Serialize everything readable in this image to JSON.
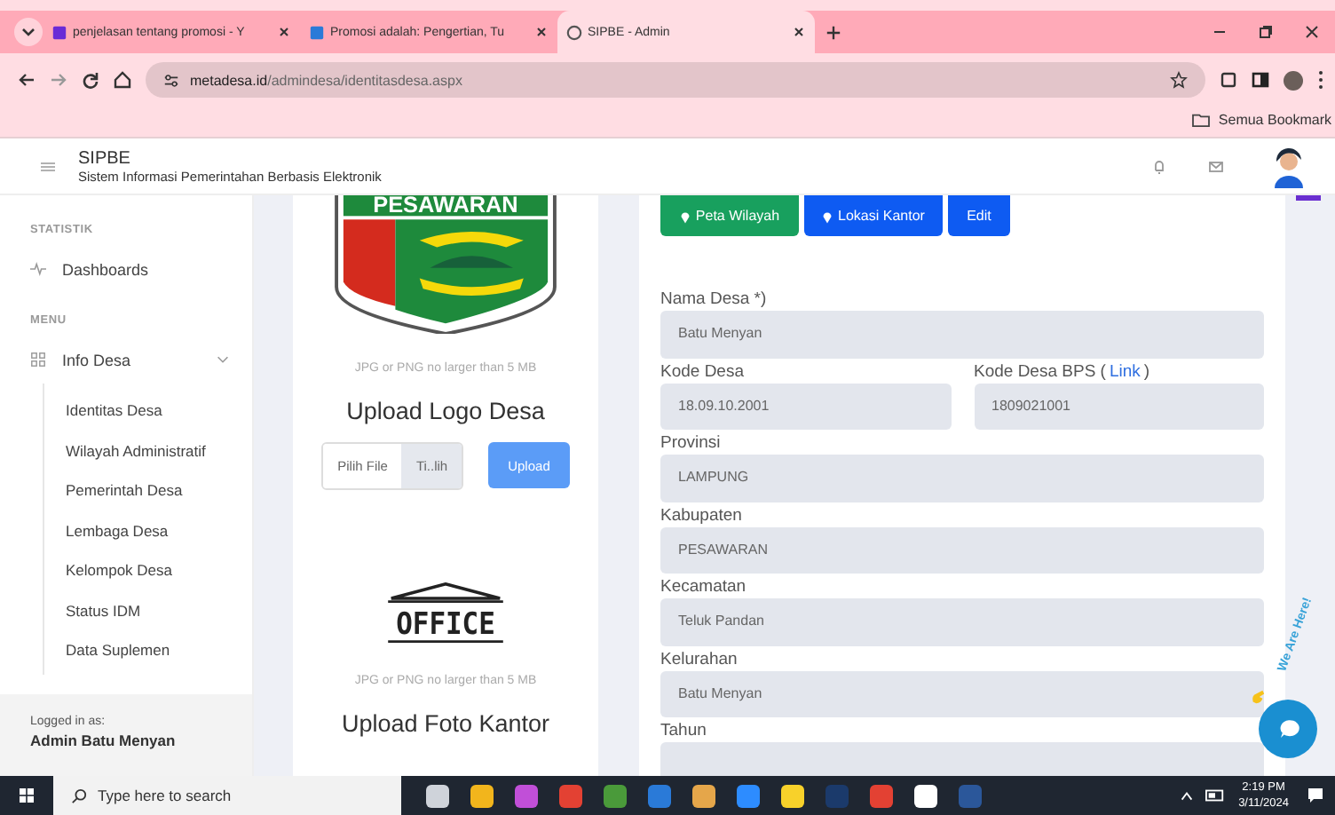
{
  "browser": {
    "tabs": [
      {
        "title": "penjelasan tentang promosi - Y",
        "selected": false
      },
      {
        "title": "Promosi adalah: Pengertian, Tu",
        "selected": false
      },
      {
        "title": "SIPBE - Admin",
        "selected": true
      }
    ],
    "url_host": "metadesa.id",
    "url_path": "/admindesa/identitasdesa.aspx",
    "bookmark": "Semua Bookmark"
  },
  "header": {
    "title": "SIPBE",
    "subtitle": "Sistem Informasi Pemerintahan Berbasis Elektronik"
  },
  "sidebar": {
    "sections": [
      {
        "heading": "STATISTIK",
        "items": [
          {
            "label": "Dashboards"
          }
        ]
      },
      {
        "heading": "MENU",
        "items": [
          {
            "label": "Info Desa",
            "expanded": true,
            "children": [
              {
                "label": "Identitas Desa"
              },
              {
                "label": "Wilayah Administratif"
              },
              {
                "label": "Pemerintah Desa"
              },
              {
                "label": "Lembaga Desa"
              },
              {
                "label": "Kelompok Desa"
              },
              {
                "label": "Status IDM"
              },
              {
                "label": "Data Suplemen"
              }
            ]
          }
        ]
      }
    ],
    "logged_in_label": "Logged in as:",
    "logged_in_user": "Admin Batu Menyan"
  },
  "uploads": [
    {
      "image_text": "PESAWARAN",
      "hint": "JPG or PNG no larger than 5 MB",
      "heading": "Upload Logo Desa",
      "file_button": "Pilih File",
      "file_status": "Ti..lih",
      "upload_button": "Upload"
    },
    {
      "image_text": "OFFICE",
      "hint": "JPG or PNG no larger than 5 MB",
      "heading": "Upload Foto Kantor"
    }
  ],
  "actions": [
    "Peta Wilayah",
    "Lokasi Kantor",
    "Edit"
  ],
  "form": {
    "rows": [
      [
        {
          "label": "Nama Desa *)",
          "value": "Batu Menyan"
        }
      ],
      [
        {
          "label": "Kode Desa",
          "value": "18.09.10.2001"
        },
        {
          "label": "Kode Desa BPS (",
          "link": "Link",
          "label_end": ")",
          "value": "1809021001"
        }
      ],
      [
        {
          "label": "Provinsi",
          "value": "LAMPUNG"
        }
      ],
      [
        {
          "label": "Kabupaten",
          "value": "PESAWARAN"
        }
      ],
      [
        {
          "label": "Kecamatan",
          "value": "Teluk Pandan"
        }
      ],
      [
        {
          "label": "Kelurahan",
          "value": "Batu Menyan"
        }
      ],
      [
        {
          "label": "Tahun"
        }
      ]
    ]
  },
  "chat": {
    "caption": "We Are Here!"
  },
  "taskbar": {
    "search_placeholder": "Type here to search",
    "time": "2:19 PM",
    "date": "3/11/2024"
  }
}
